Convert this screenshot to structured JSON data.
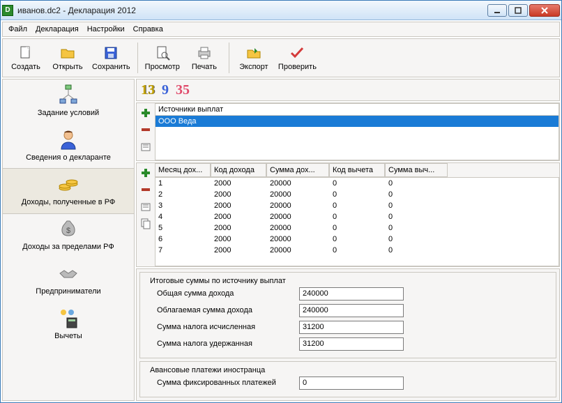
{
  "window": {
    "title": "иванов.dc2 - Декларация 2012"
  },
  "menu": {
    "file": "Файл",
    "decl": "Декларация",
    "settings": "Настройки",
    "help": "Справка"
  },
  "toolbar": {
    "create": "Создать",
    "open": "Открыть",
    "save": "Сохранить",
    "preview": "Просмотр",
    "print": "Печать",
    "export": "Экспорт",
    "check": "Проверить"
  },
  "sidebar": {
    "items": [
      {
        "label": "Задание условий"
      },
      {
        "label": "Сведения о декларанте"
      },
      {
        "label": "Доходы, полученные в РФ"
      },
      {
        "label": "Доходы за пределами РФ"
      },
      {
        "label": "Предприниматели"
      },
      {
        "label": "Вычеты"
      }
    ]
  },
  "rates": {
    "r13": "13",
    "r9": "9",
    "r35": "35"
  },
  "sources": {
    "header": "Источники выплат",
    "rows": [
      "ООО Веда"
    ]
  },
  "income": {
    "headers": {
      "month": "Месяц дох...",
      "code": "Код дохода",
      "sum": "Сумма дох...",
      "dcode": "Код вычета",
      "dsum": "Сумма выч..."
    },
    "rows": [
      {
        "m": "1",
        "c": "2000",
        "s": "20000",
        "v": "0",
        "sv": "0"
      },
      {
        "m": "2",
        "c": "2000",
        "s": "20000",
        "v": "0",
        "sv": "0"
      },
      {
        "m": "3",
        "c": "2000",
        "s": "20000",
        "v": "0",
        "sv": "0"
      },
      {
        "m": "4",
        "c": "2000",
        "s": "20000",
        "v": "0",
        "sv": "0"
      },
      {
        "m": "5",
        "c": "2000",
        "s": "20000",
        "v": "0",
        "sv": "0"
      },
      {
        "m": "6",
        "c": "2000",
        "s": "20000",
        "v": "0",
        "sv": "0"
      },
      {
        "m": "7",
        "c": "2000",
        "s": "20000",
        "v": "0",
        "sv": "0"
      }
    ]
  },
  "totals": {
    "legend": "Итоговые суммы по источнику выплат",
    "total_income_label": "Общая сумма дохода",
    "total_income": "240000",
    "taxable_label": "Облагаемая сумма дохода",
    "taxable": "240000",
    "tax_calc_label": "Сумма налога исчисленная",
    "tax_calc": "31200",
    "tax_held_label": "Сумма налога удержанная",
    "tax_held": "31200"
  },
  "advance": {
    "legend": "Авансовые платежи иностранца",
    "fixed_label": "Сумма фиксированных платежей",
    "fixed": "0"
  }
}
